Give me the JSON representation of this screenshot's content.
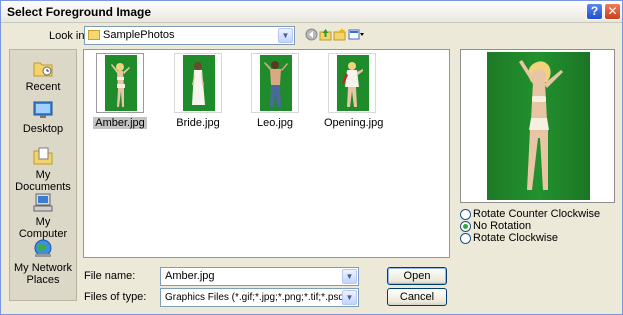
{
  "window": {
    "title": "Select Foreground Image",
    "help_glyph": "?",
    "close_glyph": "✕"
  },
  "lookin": {
    "label": "Look in:",
    "value": "SamplePhotos"
  },
  "toolbar": {
    "icons": [
      "back-icon",
      "up-folder-icon",
      "new-folder-icon",
      "views-menu-icon"
    ]
  },
  "places": [
    {
      "label": "Recent",
      "icon": "recent-folder-icon"
    },
    {
      "label": "Desktop",
      "icon": "desktop-icon"
    },
    {
      "label": "My Documents",
      "icon": "my-documents-icon"
    },
    {
      "label": "My Computer",
      "icon": "my-computer-icon"
    },
    {
      "label": "My Network Places",
      "icon": "network-places-icon"
    }
  ],
  "files": [
    {
      "name": "Amber.jpg",
      "selected": true
    },
    {
      "name": "Bride.jpg",
      "selected": false
    },
    {
      "name": "Leo.jpg",
      "selected": false
    },
    {
      "name": "Opening.jpg",
      "selected": false
    }
  ],
  "filename": {
    "label": "File name:",
    "value": "Amber.jpg"
  },
  "filetype": {
    "label": "Files of type:",
    "value": "Graphics Files (*.gif;*.jpg;*.png;*.tif;*.psd)"
  },
  "buttons": {
    "open": "Open",
    "cancel": "Cancel"
  },
  "rotation": {
    "options": [
      "Rotate Counter Clockwise",
      "No Rotation",
      "Rotate Clockwise"
    ],
    "selected": "No Rotation"
  },
  "colors": {
    "green_screen": "#1f8b2a",
    "title_close": "#c9401c",
    "title_help": "#1f4fcf"
  }
}
